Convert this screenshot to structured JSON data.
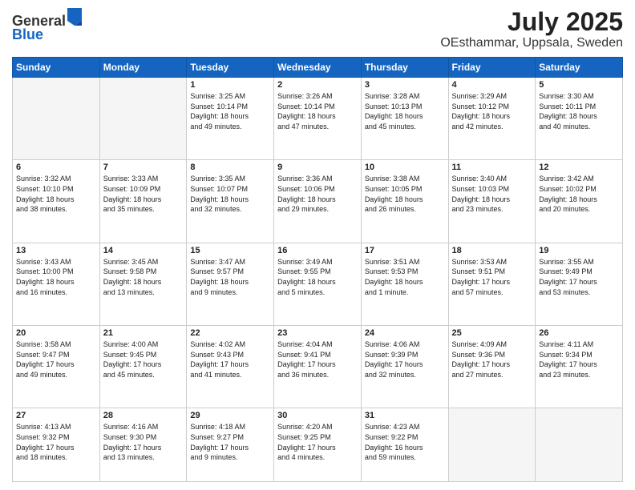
{
  "logo": {
    "general": "General",
    "blue": "Blue"
  },
  "title": "July 2025",
  "subtitle": "OEsthammar, Uppsala, Sweden",
  "days_of_week": [
    "Sunday",
    "Monday",
    "Tuesday",
    "Wednesday",
    "Thursday",
    "Friday",
    "Saturday"
  ],
  "weeks": [
    [
      {
        "day": "",
        "info": ""
      },
      {
        "day": "",
        "info": ""
      },
      {
        "day": "1",
        "info": "Sunrise: 3:25 AM\nSunset: 10:14 PM\nDaylight: 18 hours\nand 49 minutes."
      },
      {
        "day": "2",
        "info": "Sunrise: 3:26 AM\nSunset: 10:14 PM\nDaylight: 18 hours\nand 47 minutes."
      },
      {
        "day": "3",
        "info": "Sunrise: 3:28 AM\nSunset: 10:13 PM\nDaylight: 18 hours\nand 45 minutes."
      },
      {
        "day": "4",
        "info": "Sunrise: 3:29 AM\nSunset: 10:12 PM\nDaylight: 18 hours\nand 42 minutes."
      },
      {
        "day": "5",
        "info": "Sunrise: 3:30 AM\nSunset: 10:11 PM\nDaylight: 18 hours\nand 40 minutes."
      }
    ],
    [
      {
        "day": "6",
        "info": "Sunrise: 3:32 AM\nSunset: 10:10 PM\nDaylight: 18 hours\nand 38 minutes."
      },
      {
        "day": "7",
        "info": "Sunrise: 3:33 AM\nSunset: 10:09 PM\nDaylight: 18 hours\nand 35 minutes."
      },
      {
        "day": "8",
        "info": "Sunrise: 3:35 AM\nSunset: 10:07 PM\nDaylight: 18 hours\nand 32 minutes."
      },
      {
        "day": "9",
        "info": "Sunrise: 3:36 AM\nSunset: 10:06 PM\nDaylight: 18 hours\nand 29 minutes."
      },
      {
        "day": "10",
        "info": "Sunrise: 3:38 AM\nSunset: 10:05 PM\nDaylight: 18 hours\nand 26 minutes."
      },
      {
        "day": "11",
        "info": "Sunrise: 3:40 AM\nSunset: 10:03 PM\nDaylight: 18 hours\nand 23 minutes."
      },
      {
        "day": "12",
        "info": "Sunrise: 3:42 AM\nSunset: 10:02 PM\nDaylight: 18 hours\nand 20 minutes."
      }
    ],
    [
      {
        "day": "13",
        "info": "Sunrise: 3:43 AM\nSunset: 10:00 PM\nDaylight: 18 hours\nand 16 minutes."
      },
      {
        "day": "14",
        "info": "Sunrise: 3:45 AM\nSunset: 9:58 PM\nDaylight: 18 hours\nand 13 minutes."
      },
      {
        "day": "15",
        "info": "Sunrise: 3:47 AM\nSunset: 9:57 PM\nDaylight: 18 hours\nand 9 minutes."
      },
      {
        "day": "16",
        "info": "Sunrise: 3:49 AM\nSunset: 9:55 PM\nDaylight: 18 hours\nand 5 minutes."
      },
      {
        "day": "17",
        "info": "Sunrise: 3:51 AM\nSunset: 9:53 PM\nDaylight: 18 hours\nand 1 minute."
      },
      {
        "day": "18",
        "info": "Sunrise: 3:53 AM\nSunset: 9:51 PM\nDaylight: 17 hours\nand 57 minutes."
      },
      {
        "day": "19",
        "info": "Sunrise: 3:55 AM\nSunset: 9:49 PM\nDaylight: 17 hours\nand 53 minutes."
      }
    ],
    [
      {
        "day": "20",
        "info": "Sunrise: 3:58 AM\nSunset: 9:47 PM\nDaylight: 17 hours\nand 49 minutes."
      },
      {
        "day": "21",
        "info": "Sunrise: 4:00 AM\nSunset: 9:45 PM\nDaylight: 17 hours\nand 45 minutes."
      },
      {
        "day": "22",
        "info": "Sunrise: 4:02 AM\nSunset: 9:43 PM\nDaylight: 17 hours\nand 41 minutes."
      },
      {
        "day": "23",
        "info": "Sunrise: 4:04 AM\nSunset: 9:41 PM\nDaylight: 17 hours\nand 36 minutes."
      },
      {
        "day": "24",
        "info": "Sunrise: 4:06 AM\nSunset: 9:39 PM\nDaylight: 17 hours\nand 32 minutes."
      },
      {
        "day": "25",
        "info": "Sunrise: 4:09 AM\nSunset: 9:36 PM\nDaylight: 17 hours\nand 27 minutes."
      },
      {
        "day": "26",
        "info": "Sunrise: 4:11 AM\nSunset: 9:34 PM\nDaylight: 17 hours\nand 23 minutes."
      }
    ],
    [
      {
        "day": "27",
        "info": "Sunrise: 4:13 AM\nSunset: 9:32 PM\nDaylight: 17 hours\nand 18 minutes."
      },
      {
        "day": "28",
        "info": "Sunrise: 4:16 AM\nSunset: 9:30 PM\nDaylight: 17 hours\nand 13 minutes."
      },
      {
        "day": "29",
        "info": "Sunrise: 4:18 AM\nSunset: 9:27 PM\nDaylight: 17 hours\nand 9 minutes."
      },
      {
        "day": "30",
        "info": "Sunrise: 4:20 AM\nSunset: 9:25 PM\nDaylight: 17 hours\nand 4 minutes."
      },
      {
        "day": "31",
        "info": "Sunrise: 4:23 AM\nSunset: 9:22 PM\nDaylight: 16 hours\nand 59 minutes."
      },
      {
        "day": "",
        "info": ""
      },
      {
        "day": "",
        "info": ""
      }
    ]
  ]
}
